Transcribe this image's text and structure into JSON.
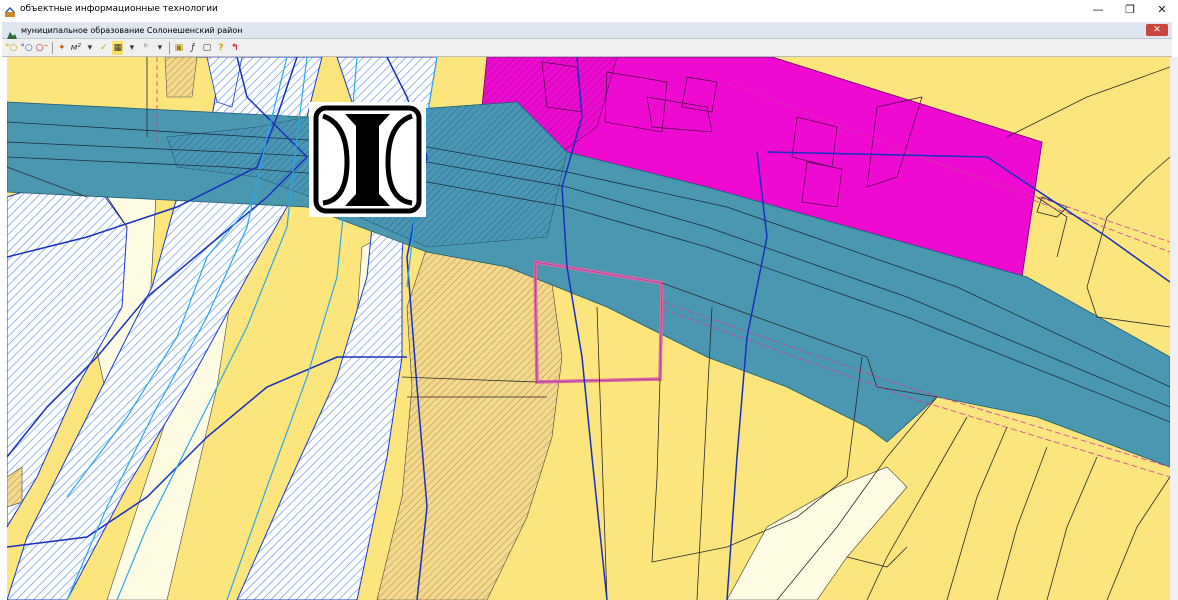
{
  "app": {
    "title": "объектные информационные технологии"
  },
  "window_controls": {
    "minimize": "—",
    "restore": "❐",
    "close": "✕"
  },
  "document": {
    "title": "муниципальное образование Солонешенский район",
    "close": "✕"
  },
  "toolbar": {
    "items": [
      "°○",
      "°○",
      "○⁻",
      "✦",
      "м²",
      "▾",
      "✓",
      "▦",
      "▾",
      "ᴵᶜ",
      "▾",
      "▣",
      "ƒ",
      "▢",
      "?",
      "↰"
    ]
  },
  "map": {
    "colors": {
      "land_yellow": "#fbe57c",
      "road_blue": "#4a97b0",
      "zone_magenta": "#ee0ad1",
      "river_hatch": "#5a8fe0",
      "light_cream": "#fdfce3",
      "selection": "#e0699b"
    },
    "sign_icon": "bridge-sign-icon"
  }
}
